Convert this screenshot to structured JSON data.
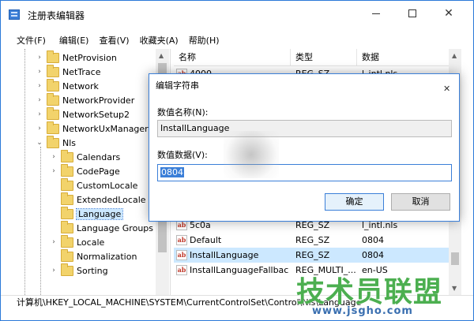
{
  "window": {
    "title": "注册表编辑器"
  },
  "menu": [
    "文件(F)",
    "编辑(E)",
    "查看(V)",
    "收藏夹(A)",
    "帮助(H)"
  ],
  "tree": [
    {
      "label": "NetProvision",
      "expander": "›",
      "indent": 0
    },
    {
      "label": "NetTrace",
      "expander": "›",
      "indent": 0
    },
    {
      "label": "Network",
      "expander": "›",
      "indent": 0
    },
    {
      "label": "NetworkProvider",
      "expander": "›",
      "indent": 0
    },
    {
      "label": "NetworkSetup2",
      "expander": "›",
      "indent": 0
    },
    {
      "label": "NetworkUxManager",
      "expander": "›",
      "indent": 0
    },
    {
      "label": "Nls",
      "expander": "⌄",
      "indent": 0
    },
    {
      "label": "Calendars",
      "expander": "›",
      "indent": 1
    },
    {
      "label": "CodePage",
      "expander": "›",
      "indent": 1
    },
    {
      "label": "CustomLocale",
      "expander": "",
      "indent": 1
    },
    {
      "label": "ExtendedLocale",
      "expander": "",
      "indent": 1
    },
    {
      "label": "Language",
      "expander": "",
      "indent": 1,
      "selected": true
    },
    {
      "label": "Language Groups",
      "expander": "",
      "indent": 1
    },
    {
      "label": "Locale",
      "expander": "›",
      "indent": 1
    },
    {
      "label": "Normalization",
      "expander": "",
      "indent": 1
    },
    {
      "label": "Sorting",
      "expander": "›",
      "indent": 1
    }
  ],
  "list": {
    "headers": [
      "名称",
      "类型",
      "数据"
    ],
    "rows_top": [
      {
        "name": "4000",
        "type": "REG_SZ",
        "data": "l_intl.nls"
      }
    ],
    "rows": [
      {
        "name": "5c0a",
        "type": "REG_SZ",
        "data": "l_intl.nls"
      },
      {
        "name": "Default",
        "type": "REG_SZ",
        "data": "0804"
      },
      {
        "name": "InstallLanguage",
        "type": "REG_SZ",
        "data": "0804",
        "selected": true
      },
      {
        "name": "InstallLanguageFallback",
        "type": "REG_MULTI_...",
        "data": "en-US"
      }
    ]
  },
  "statusbar": "计算机\\HKEY_LOCAL_MACHINE\\SYSTEM\\CurrentControlSet\\Control\\Nls\\Language",
  "dialog": {
    "title": "编辑字符串",
    "name_label": "数值名称(N):",
    "name_value": "InstallLanguage",
    "data_label": "数值数据(V):",
    "data_value": "0804",
    "ok": "确定",
    "cancel": "取消"
  },
  "watermark": {
    "text": "技术员联盟",
    "url": "www.jsgho.com"
  }
}
